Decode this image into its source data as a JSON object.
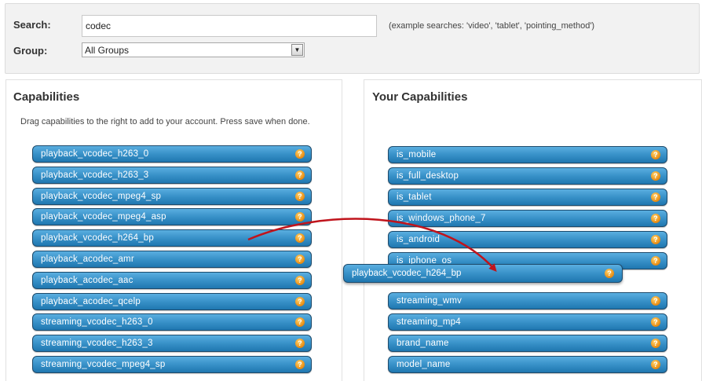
{
  "search": {
    "label": "Search:",
    "value": "codec",
    "hint": "(example searches: 'video', 'tablet', 'pointing_method')"
  },
  "group": {
    "label": "Group:",
    "selected": "All Groups",
    "arrow_glyph": "▼"
  },
  "left_panel": {
    "title": "Capabilities",
    "instructions": "Drag capabilities to the right to add to your account. Press save when done.",
    "items": [
      "playback_vcodec_h263_0",
      "playback_vcodec_h263_3",
      "playback_vcodec_mpeg4_sp",
      "playback_vcodec_mpeg4_asp",
      "playback_vcodec_h264_bp",
      "playback_acodec_amr",
      "playback_acodec_aac",
      "playback_acodec_qcelp",
      "streaming_vcodec_h263_0",
      "streaming_vcodec_h263_3",
      "streaming_vcodec_mpeg4_sp"
    ]
  },
  "right_panel": {
    "title": "Your Capabilities",
    "items": [
      "is_mobile",
      "is_full_desktop",
      "is_tablet",
      "is_windows_phone_7",
      "is_android",
      "is_iphone_os",
      "streaming_wmv",
      "streaming_mp4",
      "brand_name",
      "model_name"
    ]
  },
  "dragged_item": {
    "label": "playback_vcodec_h264_bp"
  },
  "info_icon_glyph": "?",
  "colors": {
    "item_blue": "#3891c8",
    "item_border": "#1d4a6b",
    "info_orange": "#e88a10",
    "arrow_red": "#c0141c"
  }
}
